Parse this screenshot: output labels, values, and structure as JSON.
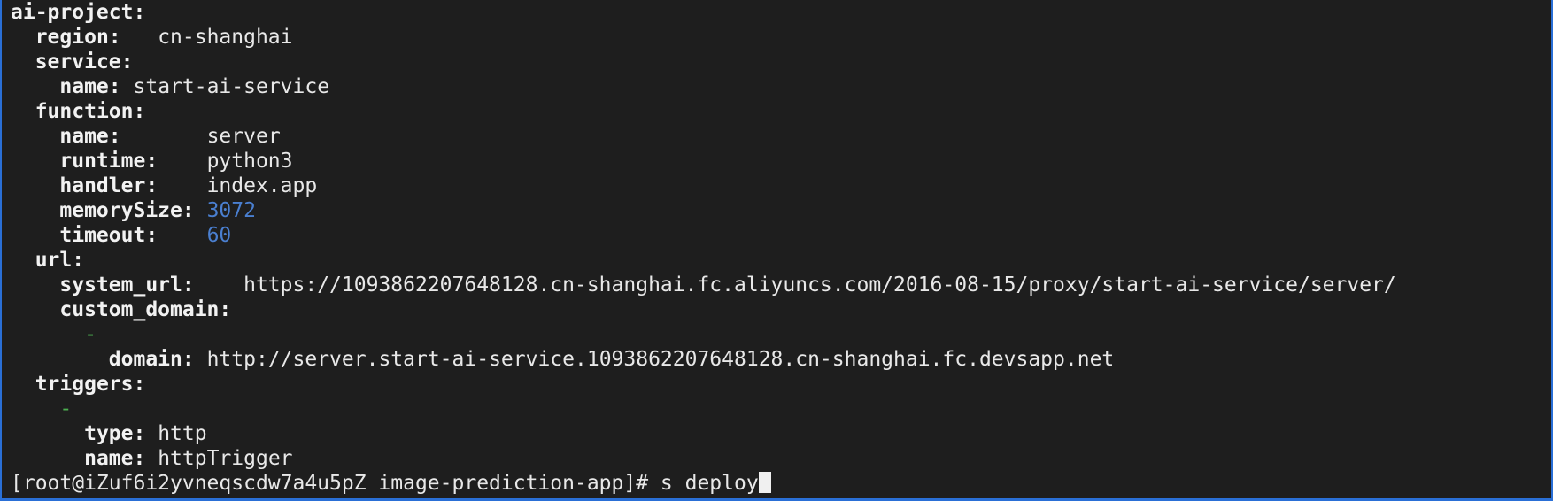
{
  "yaml": {
    "root_key": "ai-project:",
    "region_key": "region:",
    "region_value": "cn-shanghai",
    "service_key": "service:",
    "service_name_key": "name:",
    "service_name_value": "start-ai-service",
    "function_key": "function:",
    "fn_name_key": "name:",
    "fn_name_value": "server",
    "runtime_key": "runtime:",
    "runtime_value": "python3",
    "handler_key": "handler:",
    "handler_value": "index.app",
    "memory_key": "memorySize:",
    "memory_value": "3072",
    "timeout_key": "timeout:",
    "timeout_value": "60",
    "url_key": "url:",
    "system_url_key": "system_url:",
    "system_url_value": "https://1093862207648128.cn-shanghai.fc.aliyuncs.com/2016-08-15/proxy/start-ai-service/server/",
    "custom_domain_key": "custom_domain:",
    "dash": "-",
    "domain_key": "domain:",
    "domain_value": "http://server.start-ai-service.1093862207648128.cn-shanghai.fc.devsapp.net",
    "triggers_key": "triggers:",
    "trigger_type_key": "type:",
    "trigger_type_value": "http",
    "trigger_name_key": "name:",
    "trigger_name_value": "httpTrigger"
  },
  "prompt": {
    "text": "[root@iZuf6i2yvneqscdw7a4u5pZ image-prediction-app]#",
    "command": "s deploy"
  },
  "colors": {
    "background": "#1e1e1e",
    "text": "#e8e8e8",
    "number": "#4a7fd0",
    "dash": "#4caf50",
    "window_border": "#2a6fd6"
  }
}
